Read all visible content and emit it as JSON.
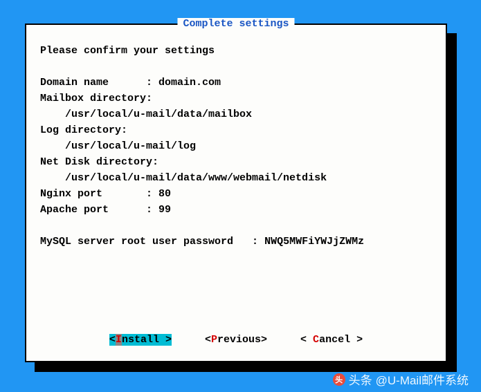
{
  "dialog": {
    "title": "Complete settings",
    "confirm_text": "Please confirm your settings",
    "fields": {
      "domain_label": "Domain name      : ",
      "domain_value": "domain.com",
      "mailbox_label": "Mailbox directory:",
      "mailbox_value": "    /usr/local/u-mail/data/mailbox",
      "log_label": "Log directory:",
      "log_value": "    /usr/local/u-mail/log",
      "netdisk_label": "Net Disk directory:",
      "netdisk_value": "    /usr/local/u-mail/data/www/webmail/netdisk",
      "nginx_label": "Nginx port       : ",
      "nginx_value": "80",
      "apache_label": "Apache port      : ",
      "apache_value": "99",
      "mysql_label": "MySQL server root user password   : ",
      "mysql_value": "NWQ5MWFiYWJjZWMz"
    },
    "buttons": {
      "install": {
        "bracket_open": "<",
        "hotkey": "I",
        "rest": "nstall ",
        "bracket_close": ">"
      },
      "previous": {
        "bracket_open": "<",
        "hotkey": "P",
        "rest": "revious",
        "bracket_close": ">"
      },
      "cancel": {
        "bracket_open": "< ",
        "hotkey": "C",
        "rest": "ancel ",
        "bracket_close": ">"
      }
    }
  },
  "watermark": {
    "prefix": "头条",
    "text": "@U-Mail邮件系统"
  }
}
